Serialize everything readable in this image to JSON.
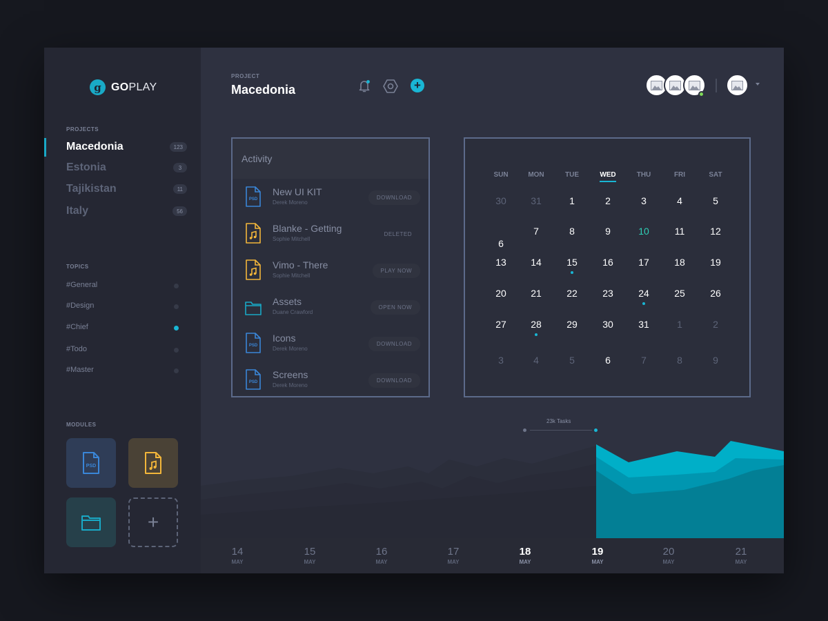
{
  "brand": {
    "name_bold": "GO",
    "name_rest": "PLAY",
    "mark": "g"
  },
  "sidebar": {
    "projects_label": "PROJECTS",
    "projects": [
      {
        "name": "Macedonia",
        "count": "123",
        "active": true
      },
      {
        "name": "Estonia",
        "count": "3"
      },
      {
        "name": "Tajikistan",
        "count": "11"
      },
      {
        "name": "Italy",
        "count": "56"
      }
    ],
    "topics_label": "TOPICS",
    "topics": [
      {
        "name": "#General",
        "active": false
      },
      {
        "name": "#Design",
        "active": false
      },
      {
        "name": "#Chief",
        "active": true
      },
      {
        "name": "#Todo",
        "active": false
      },
      {
        "name": "#Master",
        "active": false
      }
    ],
    "modules_label": "MODULES",
    "modules": [
      {
        "icon": "psd-file-icon",
        "text": "PSD",
        "color": "#3a86d8"
      },
      {
        "icon": "music-file-icon",
        "color": "#f3b63a"
      },
      {
        "icon": "folder-icon",
        "color": "#19a9c6"
      },
      {
        "icon": "plus-icon",
        "text": "+"
      }
    ]
  },
  "header": {
    "project_label": "PROJECT",
    "project_title": "Macedonia",
    "icons": [
      "bell-icon",
      "settings-hexagon-icon",
      "plus-icon"
    ],
    "add_symbol": "+"
  },
  "activity": {
    "title": "Activity",
    "items": [
      {
        "title": "New UI KIT",
        "author": "Derek Moreno",
        "action": "DOWNLOAD",
        "icon": "psd-file-icon",
        "icon_text": "PSD"
      },
      {
        "title": "Blanke - Getting",
        "author": "Sophie Mitchell",
        "action": "DELETED",
        "icon": "music-file-icon"
      },
      {
        "title": "Vimo - There",
        "author": "Sophie Mitchell",
        "action": "PLAY NOW",
        "icon": "music-file-icon"
      },
      {
        "title": "Assets",
        "author": "Duane Crawford",
        "action": "OPEN NOW",
        "icon": "folder-icon"
      },
      {
        "title": "Icons",
        "author": "Derek Moreno",
        "action": "DOWNLOAD",
        "icon": "psd-file-icon",
        "icon_text": "PSD"
      },
      {
        "title": "Screens",
        "author": "Derek Moreno",
        "action": "DOWNLOAD",
        "icon": "psd-file-icon",
        "icon_text": "PSD"
      }
    ]
  },
  "calendar": {
    "days_of_week": [
      "SUN",
      "MON",
      "TUE",
      "WED",
      "THU",
      "FRI",
      "SAT"
    ],
    "current_dow": "WED",
    "weeks": [
      [
        "30",
        "31",
        "1",
        "2",
        "3",
        "4",
        "5"
      ],
      [
        "6",
        "7",
        "8",
        "9",
        "10",
        "11",
        "12"
      ],
      [
        "13",
        "14",
        "15",
        "16",
        "17",
        "18",
        "19"
      ],
      [
        "20",
        "21",
        "22",
        "23",
        "24",
        "25",
        "26"
      ],
      [
        "27",
        "28",
        "29",
        "30",
        "31",
        "1",
        "2"
      ],
      [
        "3",
        "4",
        "5",
        "6",
        "7",
        "8",
        "9"
      ]
    ],
    "muted": [
      "0-0",
      "0-1",
      "4-5",
      "4-6",
      "5-0",
      "5-1",
      "5-2",
      "5-4",
      "5-5",
      "5-6"
    ],
    "accent": [
      "1-4"
    ],
    "dotted": [
      "2-2",
      "3-4",
      "4-1"
    ]
  },
  "timeline": {
    "tasks_label": "23k Tasks",
    "dates": [
      {
        "day": "14",
        "month": "MAY"
      },
      {
        "day": "15",
        "month": "MAY"
      },
      {
        "day": "16",
        "month": "MAY"
      },
      {
        "day": "17",
        "month": "MAY"
      },
      {
        "day": "18",
        "month": "MAY",
        "highlight": true
      },
      {
        "day": "19",
        "month": "MAY",
        "highlight": true
      },
      {
        "day": "20",
        "month": "MAY"
      },
      {
        "day": "21",
        "month": "MAY"
      }
    ],
    "accent_color": "#19b6d4"
  },
  "colors": {
    "accent": "#19b6d4",
    "green": "#2fcfb6",
    "online": "#7ed957"
  }
}
